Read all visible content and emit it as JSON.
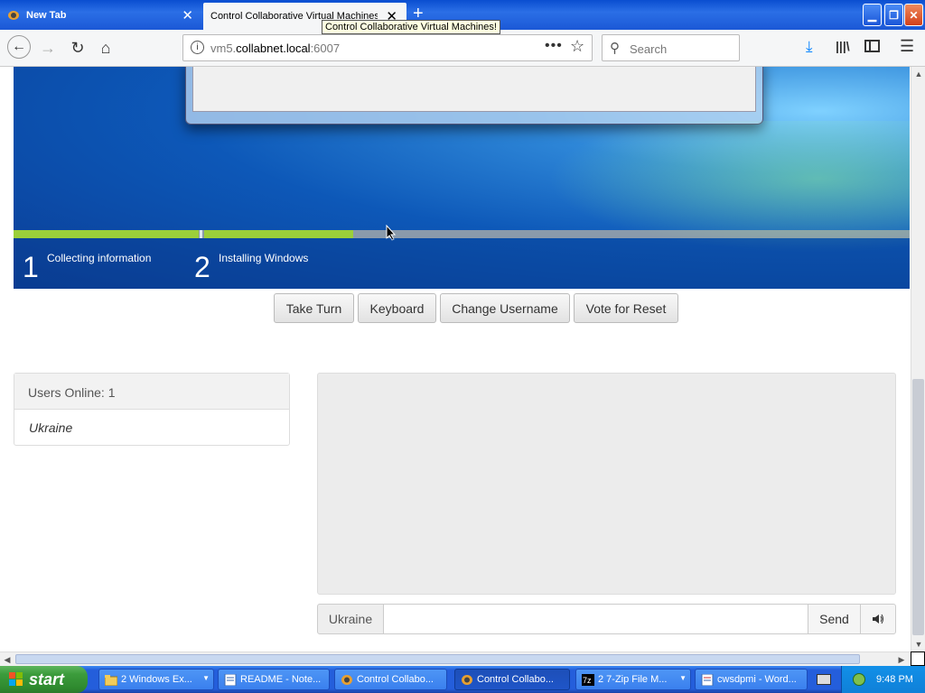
{
  "browser": {
    "tabs": [
      {
        "label": "New Tab",
        "active": false
      },
      {
        "label": "Control Collaborative Virtual Machines!",
        "active": true
      }
    ],
    "tooltip": "Control Collaborative Virtual Machines!",
    "url": {
      "prefix": "vm5.",
      "domain": "collabnet.local",
      "suffix": ":6007"
    },
    "search_placeholder": "Search",
    "icons": {
      "back": "back-arrow-icon",
      "forward": "forward-arrow-icon",
      "reload": "reload-icon",
      "home": "home-icon",
      "page_actions": "ellipsis-icon",
      "bookmark": "star-icon",
      "download": "download-icon",
      "library": "library-icon",
      "sidebar": "sidebar-icon",
      "menu": "hamburger-menu-icon"
    }
  },
  "vm": {
    "steps": [
      {
        "number": "1",
        "label": "Collecting information"
      },
      {
        "number": "2",
        "label": "Installing Windows"
      }
    ],
    "progress_colors": {
      "done": "#9bcf3a",
      "track": "#8a9aab"
    }
  },
  "controls": {
    "take_turn": "Take Turn",
    "keyboard": "Keyboard",
    "change_username": "Change Username",
    "vote_reset": "Vote for Reset"
  },
  "users": {
    "header": "Users Online: 1",
    "list": [
      "Ukraine"
    ]
  },
  "chat": {
    "username": "Ukraine",
    "message_value": "",
    "send_label": "Send",
    "sound_icon": "speaker-icon"
  },
  "taskbar": {
    "start_label": "start",
    "tasks": [
      {
        "label": "2 Windows Ex...",
        "icon": "folder-icon",
        "group": true,
        "active": false
      },
      {
        "label": "README - Note...",
        "icon": "notepad-icon",
        "group": false,
        "active": false
      },
      {
        "label": "Control Collabo...",
        "icon": "firefox-icon",
        "group": false,
        "active": false
      },
      {
        "label": "Control Collabo...",
        "icon": "firefox-icon",
        "group": false,
        "active": true
      },
      {
        "label": "2 7-Zip File M...",
        "icon": "7zip-icon",
        "group": true,
        "active": false
      },
      {
        "label": "cwsdpmi - Word...",
        "icon": "wordpad-icon",
        "group": false,
        "active": false
      }
    ],
    "clock": "9:48 PM"
  }
}
